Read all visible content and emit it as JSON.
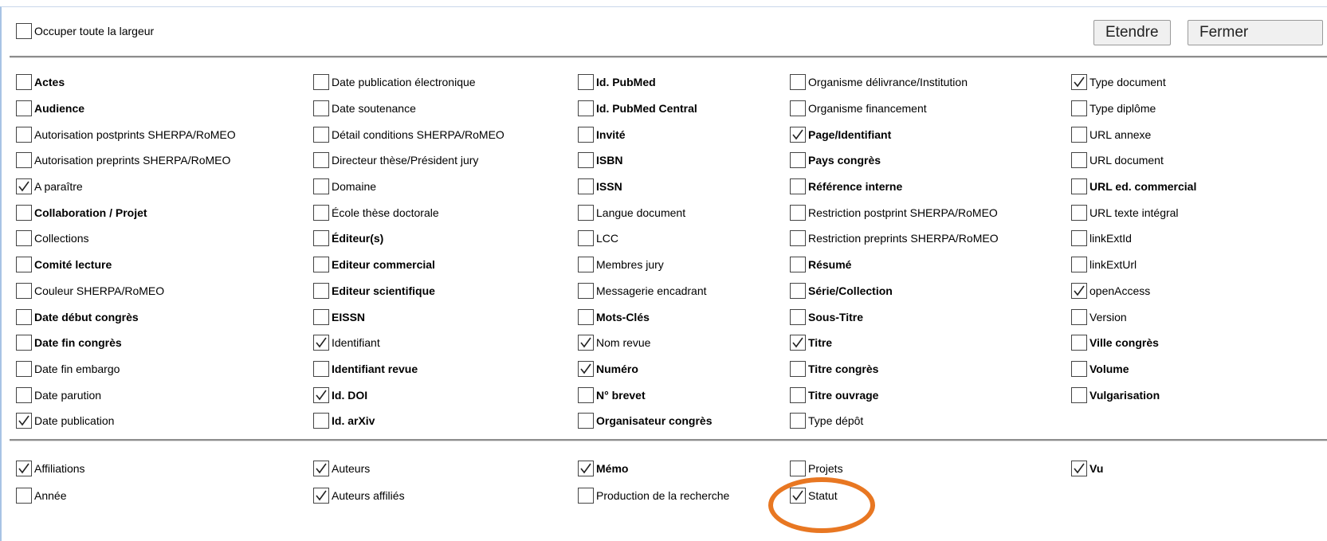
{
  "header": {
    "full_width_label": "Occuper toute la largeur",
    "full_width_checked": false,
    "extend_label": "Etendre",
    "close_label": "Fermer"
  },
  "fields": [
    [
      {
        "label": "Actes",
        "checked": false,
        "bold": true
      },
      {
        "label": "Audience",
        "checked": false,
        "bold": true
      },
      {
        "label": "Autorisation postprints SHERPA/RoMEO",
        "checked": false,
        "bold": false
      },
      {
        "label": "Autorisation preprints SHERPA/RoMEO",
        "checked": false,
        "bold": false
      },
      {
        "label": "A paraître",
        "checked": true,
        "bold": false
      },
      {
        "label": "Collaboration / Projet",
        "checked": false,
        "bold": true
      },
      {
        "label": "Collections",
        "checked": false,
        "bold": false
      },
      {
        "label": "Comité lecture",
        "checked": false,
        "bold": true
      },
      {
        "label": "Couleur SHERPA/RoMEO",
        "checked": false,
        "bold": false
      },
      {
        "label": "Date début congrès",
        "checked": false,
        "bold": true
      },
      {
        "label": "Date fin congrès",
        "checked": false,
        "bold": true
      },
      {
        "label": "Date fin embargo",
        "checked": false,
        "bold": false
      },
      {
        "label": "Date parution",
        "checked": false,
        "bold": false
      },
      {
        "label": "Date publication",
        "checked": true,
        "bold": false
      }
    ],
    [
      {
        "label": "Date publication électronique",
        "checked": false,
        "bold": false
      },
      {
        "label": "Date soutenance",
        "checked": false,
        "bold": false
      },
      {
        "label": "Détail conditions SHERPA/RoMEO",
        "checked": false,
        "bold": false
      },
      {
        "label": "Directeur thèse/Président jury",
        "checked": false,
        "bold": false
      },
      {
        "label": "Domaine",
        "checked": false,
        "bold": false
      },
      {
        "label": "École thèse doctorale",
        "checked": false,
        "bold": false
      },
      {
        "label": "Éditeur(s)",
        "checked": false,
        "bold": true
      },
      {
        "label": "Editeur commercial",
        "checked": false,
        "bold": true
      },
      {
        "label": "Editeur scientifique",
        "checked": false,
        "bold": true
      },
      {
        "label": "EISSN",
        "checked": false,
        "bold": true
      },
      {
        "label": "Identifiant",
        "checked": true,
        "bold": false
      },
      {
        "label": "Identifiant revue",
        "checked": false,
        "bold": true
      },
      {
        "label": "Id. DOI",
        "checked": true,
        "bold": true
      },
      {
        "label": "Id. arXiv",
        "checked": false,
        "bold": true
      }
    ],
    [
      {
        "label": "Id. PubMed",
        "checked": false,
        "bold": true
      },
      {
        "label": "Id. PubMed Central",
        "checked": false,
        "bold": true
      },
      {
        "label": "Invité",
        "checked": false,
        "bold": true
      },
      {
        "label": "ISBN",
        "checked": false,
        "bold": true
      },
      {
        "label": "ISSN",
        "checked": false,
        "bold": true
      },
      {
        "label": "Langue document",
        "checked": false,
        "bold": false
      },
      {
        "label": "LCC",
        "checked": false,
        "bold": false
      },
      {
        "label": "Membres jury",
        "checked": false,
        "bold": false
      },
      {
        "label": "Messagerie encadrant",
        "checked": false,
        "bold": false
      },
      {
        "label": "Mots-Clés",
        "checked": false,
        "bold": true
      },
      {
        "label": "Nom revue",
        "checked": true,
        "bold": false
      },
      {
        "label": "Numéro",
        "checked": true,
        "bold": true
      },
      {
        "label": "N° brevet",
        "checked": false,
        "bold": true
      },
      {
        "label": "Organisateur congrès",
        "checked": false,
        "bold": true
      }
    ],
    [
      {
        "label": "Organisme délivrance/Institution",
        "checked": false,
        "bold": false
      },
      {
        "label": "Organisme financement",
        "checked": false,
        "bold": false
      },
      {
        "label": "Page/Identifiant",
        "checked": true,
        "bold": true
      },
      {
        "label": "Pays congrès",
        "checked": false,
        "bold": true
      },
      {
        "label": "Référence interne",
        "checked": false,
        "bold": true
      },
      {
        "label": "Restriction postprint SHERPA/RoMEO",
        "checked": false,
        "bold": false
      },
      {
        "label": "Restriction preprints SHERPA/RoMEO",
        "checked": false,
        "bold": false
      },
      {
        "label": "Résumé",
        "checked": false,
        "bold": true
      },
      {
        "label": "Série/Collection",
        "checked": false,
        "bold": true
      },
      {
        "label": "Sous-Titre",
        "checked": false,
        "bold": true
      },
      {
        "label": "Titre",
        "checked": true,
        "bold": true
      },
      {
        "label": "Titre congrès",
        "checked": false,
        "bold": true
      },
      {
        "label": "Titre ouvrage",
        "checked": false,
        "bold": true
      },
      {
        "label": "Type dépôt",
        "checked": false,
        "bold": false
      }
    ],
    [
      {
        "label": "Type document",
        "checked": true,
        "bold": false
      },
      {
        "label": "Type diplôme",
        "checked": false,
        "bold": false
      },
      {
        "label": "URL annexe",
        "checked": false,
        "bold": false
      },
      {
        "label": "URL document",
        "checked": false,
        "bold": false
      },
      {
        "label": "URL ed. commercial",
        "checked": false,
        "bold": true
      },
      {
        "label": "URL texte intégral",
        "checked": false,
        "bold": false
      },
      {
        "label": "linkExtId",
        "checked": false,
        "bold": false
      },
      {
        "label": "linkExtUrl",
        "checked": false,
        "bold": false
      },
      {
        "label": "openAccess",
        "checked": true,
        "bold": false
      },
      {
        "label": "Version",
        "checked": false,
        "bold": false
      },
      {
        "label": "Ville congrès",
        "checked": false,
        "bold": true
      },
      {
        "label": "Volume",
        "checked": false,
        "bold": true
      },
      {
        "label": "Vulgarisation",
        "checked": false,
        "bold": true
      }
    ]
  ],
  "extra_fields": [
    [
      {
        "label": "Affiliations",
        "checked": true,
        "bold": false
      },
      {
        "label": "Année",
        "checked": false,
        "bold": false
      }
    ],
    [
      {
        "label": "Auteurs",
        "checked": true,
        "bold": false
      },
      {
        "label": "Auteurs affiliés",
        "checked": true,
        "bold": false
      }
    ],
    [
      {
        "label": "Mémo",
        "checked": true,
        "bold": true
      },
      {
        "label": "Production de la recherche",
        "checked": false,
        "bold": false
      }
    ],
    [
      {
        "label": "Projets",
        "checked": false,
        "bold": false
      },
      {
        "label": "Statut",
        "checked": true,
        "bold": false
      }
    ],
    [
      {
        "label": "Vu",
        "checked": true,
        "bold": true
      }
    ]
  ],
  "highlighted_field": "Statut",
  "colors": {
    "highlight": "#e87722",
    "panel_border": "#a8c3e4"
  }
}
